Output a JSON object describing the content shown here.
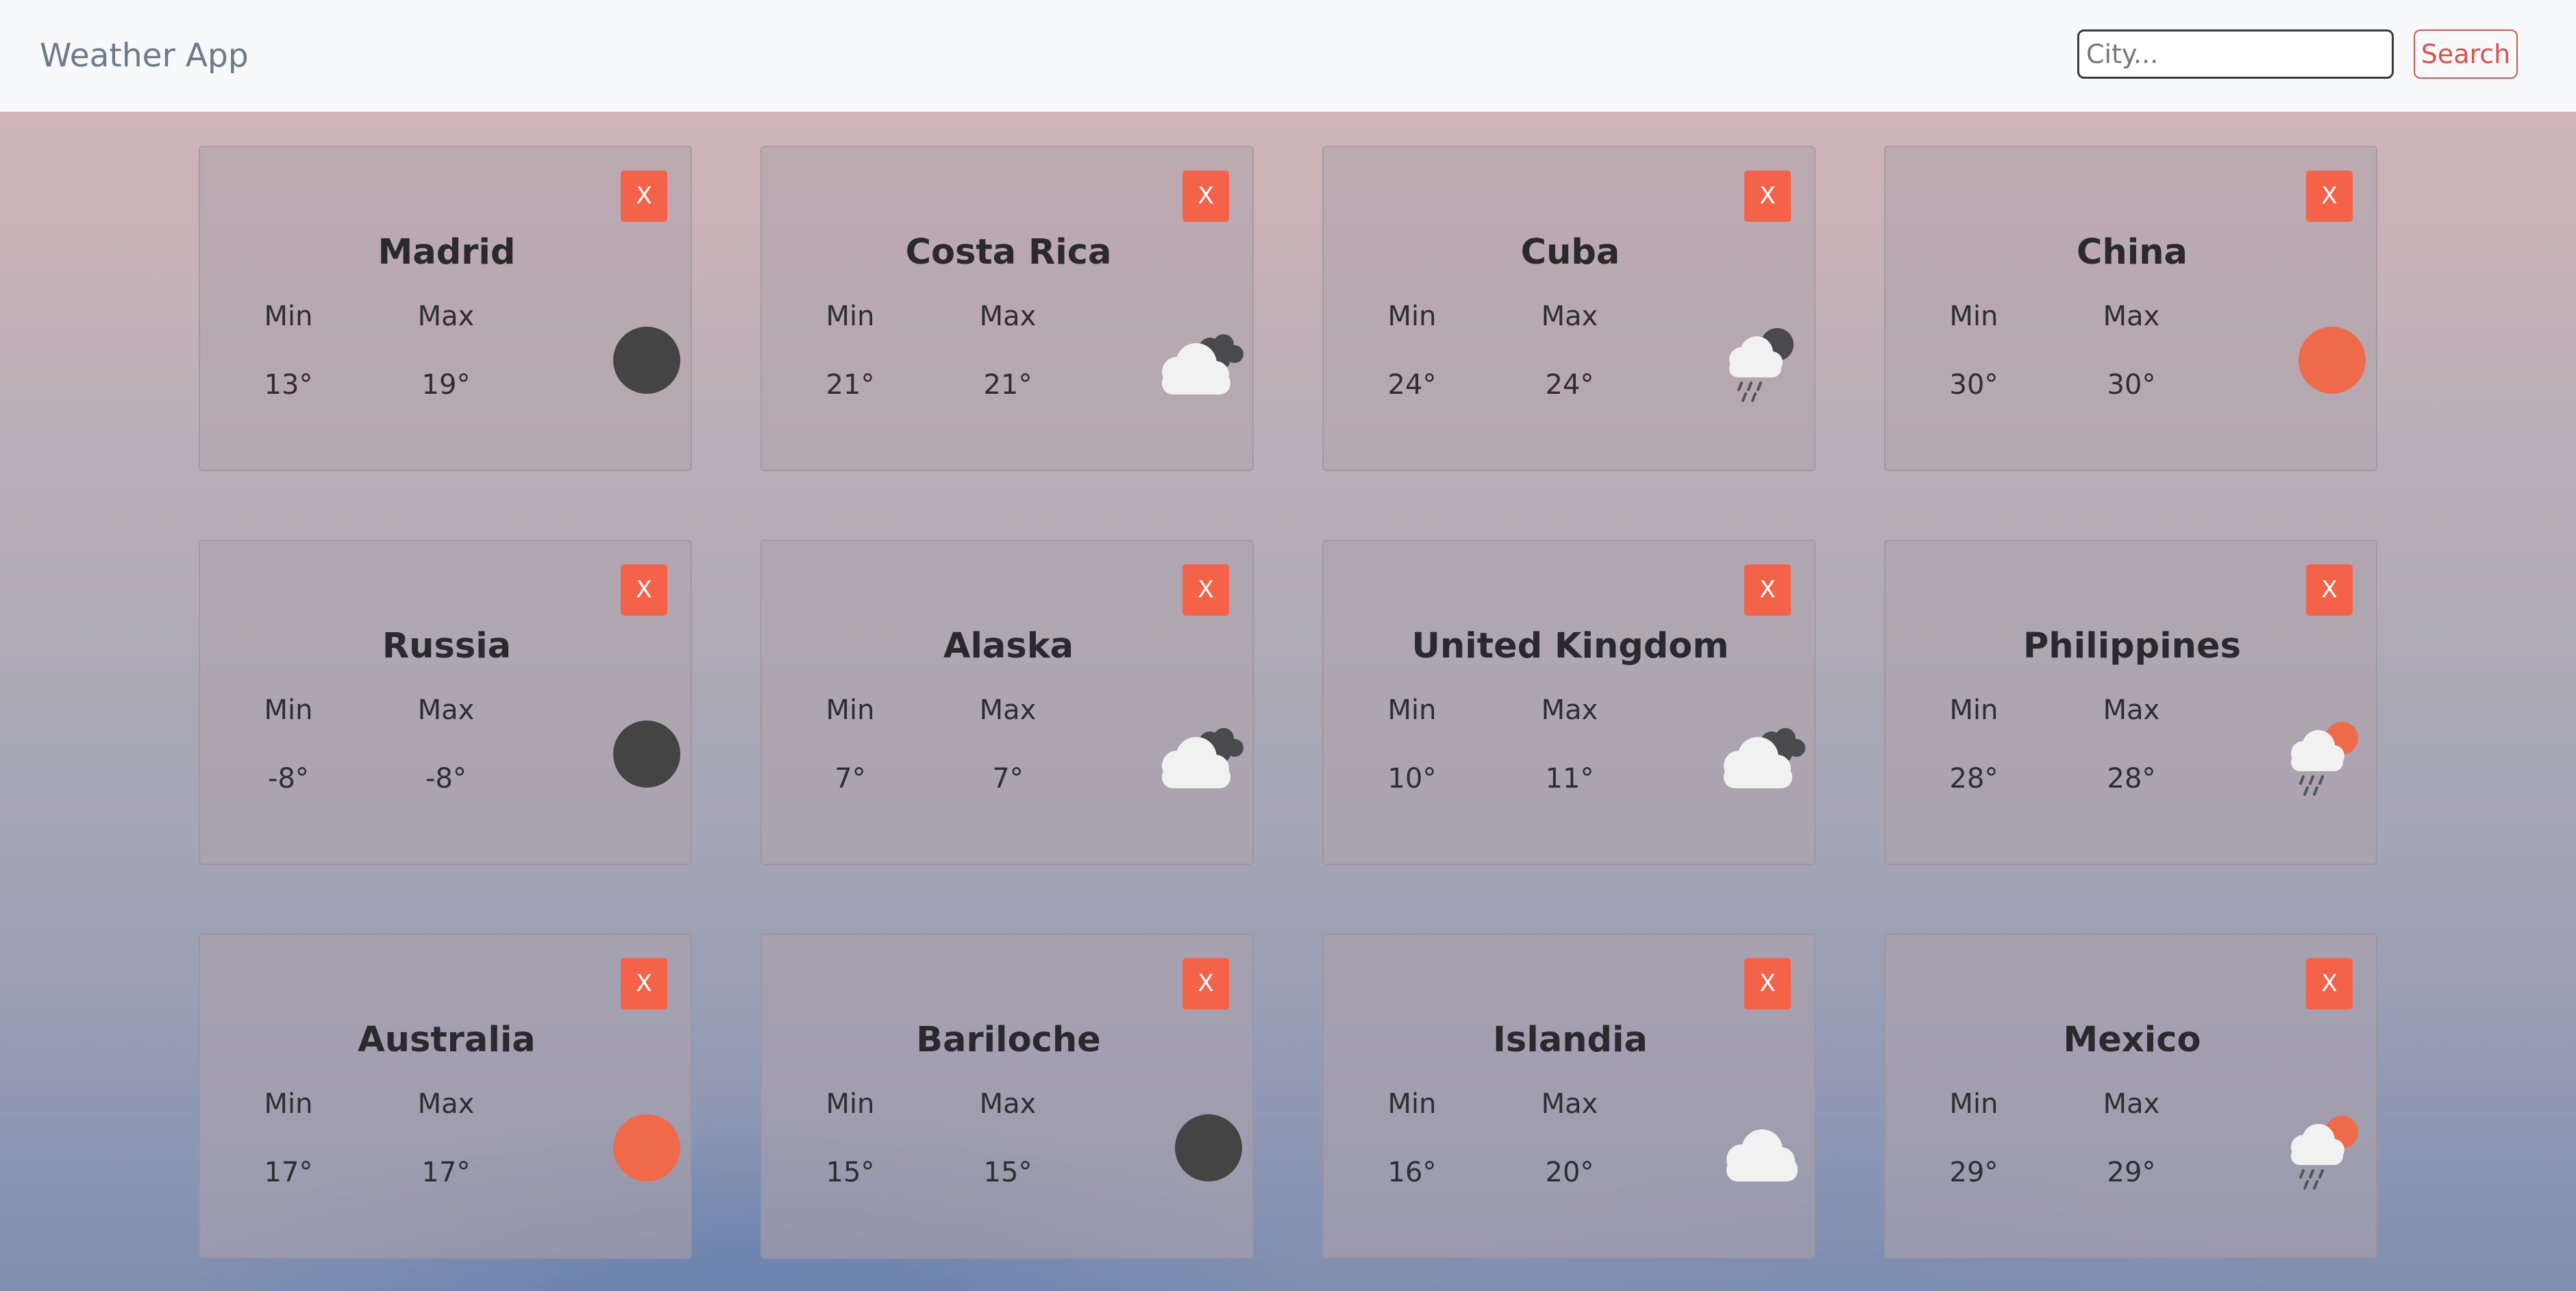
{
  "navbar": {
    "brand": "Weather App",
    "search_placeholder": "City...",
    "search_label": "Search"
  },
  "labels": {
    "min": "Min",
    "max": "Max",
    "close": "X"
  },
  "cards": [
    {
      "city": "Madrid",
      "min": "13°",
      "max": "19°",
      "icon": "dark-disc-icon"
    },
    {
      "city": "Costa Rica",
      "min": "21°",
      "max": "21°",
      "icon": "cloudy-icon"
    },
    {
      "city": "Cuba",
      "min": "24°",
      "max": "24°",
      "icon": "rain-night-icon"
    },
    {
      "city": "China",
      "min": "30°",
      "max": "30°",
      "icon": "sun-icon"
    },
    {
      "city": "Russia",
      "min": "-8°",
      "max": "-8°",
      "icon": "dark-disc-icon"
    },
    {
      "city": "Alaska",
      "min": "7°",
      "max": "7°",
      "icon": "cloudy-icon"
    },
    {
      "city": "United Kingdom",
      "min": "10°",
      "max": "11°",
      "icon": "cloudy-icon"
    },
    {
      "city": "Philippines",
      "min": "28°",
      "max": "28°",
      "icon": "rain-sun-icon"
    },
    {
      "city": "Australia",
      "min": "17°",
      "max": "17°",
      "icon": "sun-icon"
    },
    {
      "city": "Bariloche",
      "min": "15°",
      "max": "15°",
      "icon": "dark-disc-icon"
    },
    {
      "city": "Islandia",
      "min": "16°",
      "max": "20°",
      "icon": "cloud-icon"
    },
    {
      "city": "Mexico",
      "min": "29°",
      "max": "29°",
      "icon": "rain-sun-icon"
    }
  ],
  "colors": {
    "close_button": "#f4624a",
    "search_button": "#d9534f",
    "sun": "#ee6a4a",
    "dark_disc": "#444444"
  }
}
